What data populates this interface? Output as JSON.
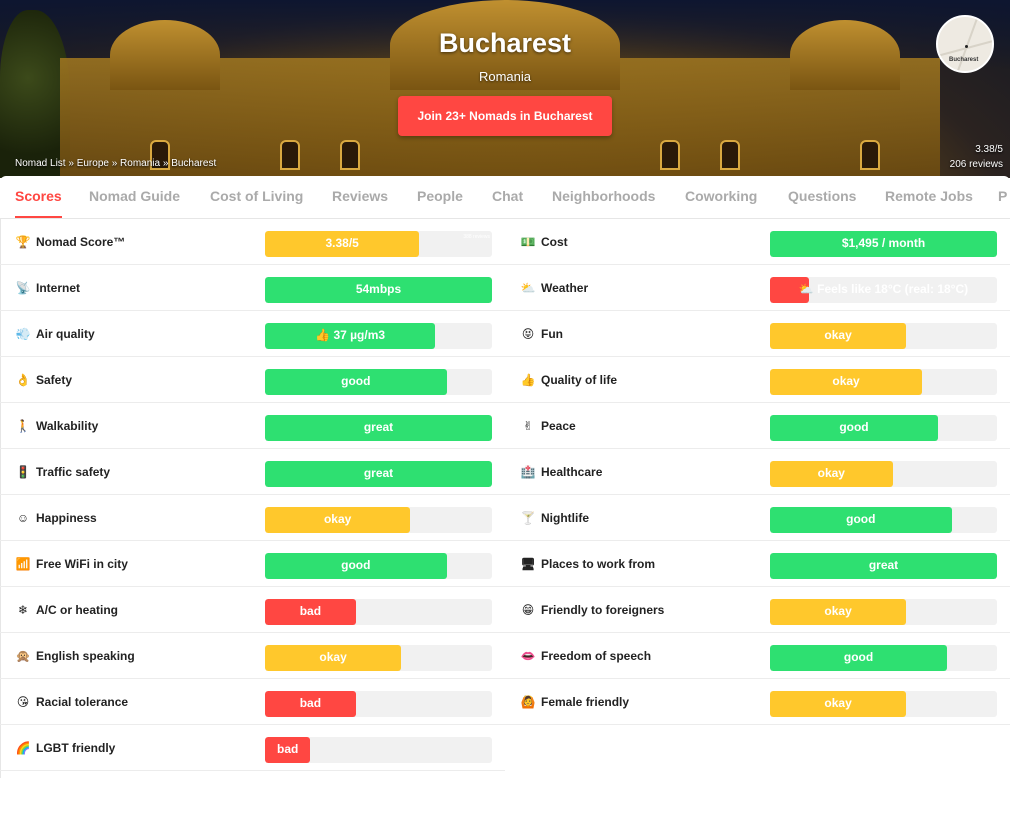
{
  "hero": {
    "city": "Bucharest",
    "country": "Romania",
    "join_label": "Join 23+ Nomads in Bucharest",
    "breadcrumb": "Nomad List » Europe » Romania » Bucharest",
    "score": "3.38/5",
    "reviews": "206 reviews",
    "map_label": "Bucharest"
  },
  "tabs": [
    "Scores",
    "Nomad Guide",
    "Cost of Living",
    "Reviews",
    "People",
    "Chat",
    "Neighborhoods",
    "Coworking",
    "Questions",
    "Remote Jobs",
    "P"
  ],
  "colors": {
    "green": "#2ee071",
    "yellow": "#ffc82c",
    "red": "#ff4742"
  },
  "left": [
    {
      "icon": "🏆",
      "icon_name": "trophy-icon",
      "label": "Nomad Score™",
      "value": "3.38/5",
      "level": 0.68,
      "color": "yellow",
      "fine": "388 reviews"
    },
    {
      "icon": "📡",
      "icon_name": "satellite-icon",
      "label": "Internet",
      "value": "54mbps",
      "level": 1.0,
      "color": "green"
    },
    {
      "icon": "💨",
      "icon_name": "wind-icon",
      "label": "Air quality",
      "value": "👍 37 µg/m3",
      "level": 0.75,
      "color": "green"
    },
    {
      "icon": "👌",
      "icon_name": "ok-hand-icon",
      "label": "Safety",
      "value": "good",
      "level": 0.8,
      "color": "green"
    },
    {
      "icon": "🚶",
      "icon_name": "walking-icon",
      "label": "Walkability",
      "value": "great",
      "level": 1.0,
      "color": "green"
    },
    {
      "icon": "🚦",
      "icon_name": "traffic-light-icon",
      "label": "Traffic safety",
      "value": "great",
      "level": 1.0,
      "color": "green"
    },
    {
      "icon": "☺",
      "icon_name": "smile-icon",
      "label": "Happiness",
      "value": "okay",
      "level": 0.64,
      "color": "yellow"
    },
    {
      "icon": "📶",
      "icon_name": "wifi-icon",
      "label": "Free WiFi in city",
      "value": "good",
      "level": 0.8,
      "color": "green"
    },
    {
      "icon": "❄",
      "icon_name": "snowflake-icon",
      "label": "A/C or heating",
      "value": "bad",
      "level": 0.4,
      "color": "red"
    },
    {
      "icon": "🙊",
      "icon_name": "monkey-icon",
      "label": "English speaking",
      "value": "okay",
      "level": 0.6,
      "color": "yellow"
    },
    {
      "icon": "😘",
      "icon_name": "kiss-icon",
      "label": "Racial tolerance",
      "value": "bad",
      "level": 0.4,
      "color": "red"
    },
    {
      "icon": "🌈",
      "icon_name": "rainbow-icon",
      "label": "LGBT friendly",
      "value": "bad",
      "level": 0.2,
      "color": "red"
    }
  ],
  "right": [
    {
      "icon": "💵",
      "icon_name": "money-icon",
      "label": "Cost",
      "value": "$1,495 / month",
      "level": 1.0,
      "color": "green"
    },
    {
      "icon": "⛅",
      "icon_name": "cloud-icon",
      "label": "Weather",
      "value": "⛅ Feels like 18°C (real: 18°C)",
      "level": 0.17,
      "color": "red"
    },
    {
      "icon": "😝",
      "icon_name": "fun-face-icon",
      "label": "Fun",
      "value": "okay",
      "level": 0.6,
      "color": "yellow"
    },
    {
      "icon": "👍",
      "icon_name": "thumbs-up-icon",
      "label": "Quality of life",
      "value": "okay",
      "level": 0.67,
      "color": "yellow"
    },
    {
      "icon": "✌",
      "icon_name": "peace-icon",
      "label": "Peace",
      "value": "good",
      "level": 0.74,
      "color": "green"
    },
    {
      "icon": "🏥",
      "icon_name": "hospital-icon",
      "label": "Healthcare",
      "value": "okay",
      "level": 0.54,
      "color": "yellow"
    },
    {
      "icon": "🍸",
      "icon_name": "cocktail-icon",
      "label": "Nightlife",
      "value": "good",
      "level": 0.8,
      "color": "green"
    },
    {
      "icon": "🖥",
      "icon_name": "desk-icon",
      "label": "Places to work from",
      "value": "great",
      "level": 1.0,
      "color": "green"
    },
    {
      "icon": "😁",
      "icon_name": "grin-icon",
      "label": "Friendly to foreigners",
      "value": "okay",
      "level": 0.6,
      "color": "yellow"
    },
    {
      "icon": "👄",
      "icon_name": "speech-icon",
      "label": "Freedom of speech",
      "value": "good",
      "level": 0.78,
      "color": "green"
    },
    {
      "icon": "🙆",
      "icon_name": "woman-icon",
      "label": "Female friendly",
      "value": "okay",
      "level": 0.6,
      "color": "yellow"
    }
  ]
}
